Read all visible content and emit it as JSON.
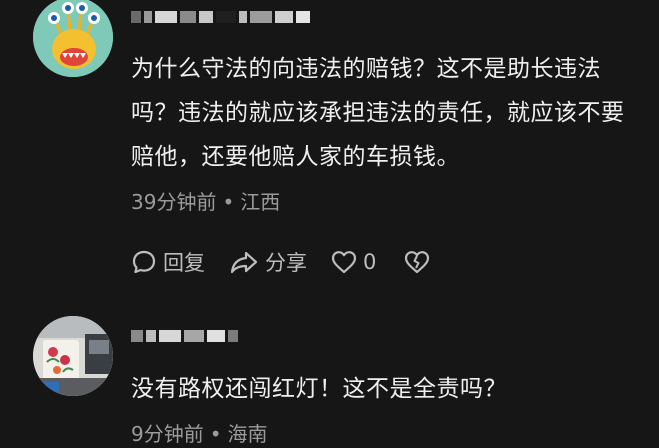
{
  "comments": [
    {
      "text": "为什么守法的向违法的赔钱？这不是助长违法吗？违法的就应该承担违法的责任，就应该不要赔他，还要他赔人家的车损钱。",
      "time": "39分钟前",
      "separator": "•",
      "location": "江西",
      "reply_label": "回复",
      "share_label": "分享",
      "like_count": "0"
    },
    {
      "text": "没有路权还闯红灯！这不是全责吗？",
      "time": "9分钟前",
      "separator": "•",
      "location": "海南"
    }
  ],
  "icons": {
    "reply": "comment-bubble-icon",
    "share": "share-arrow-icon",
    "like": "heart-icon",
    "dislike": "broken-heart-icon"
  },
  "colors": {
    "background": "#161616",
    "text": "#f0f0f0",
    "meta": "#9b9b9b",
    "action": "#bdbdbd"
  }
}
